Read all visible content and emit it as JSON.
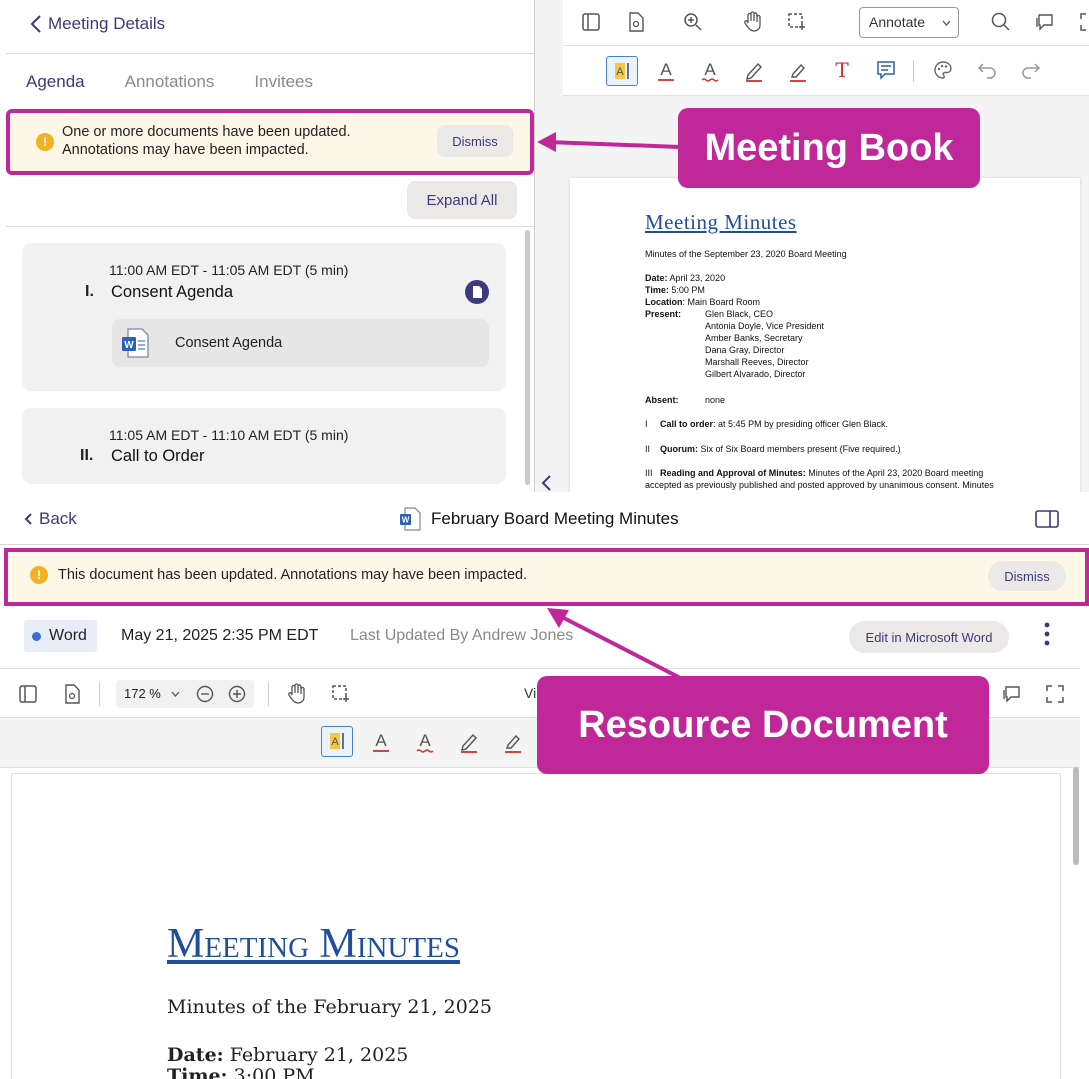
{
  "meeting_panel": {
    "back_label": "Meeting Details",
    "tabs": [
      {
        "label": "Agenda",
        "active": true
      },
      {
        "label": "Annotations",
        "active": false
      },
      {
        "label": "Invitees",
        "active": false
      }
    ],
    "banner": {
      "line1": "One or more documents have been updated.",
      "line2": "Annotations may have been impacted.",
      "dismiss": "Dismiss",
      "icon": "exclamation"
    },
    "expand_all": "Expand All",
    "agenda": [
      {
        "time": "11:00 AM EDT - 11:05 AM EDT (5 min)",
        "number": "I.",
        "title": "Consent Agenda",
        "document": "Consent Agenda"
      },
      {
        "time": "11:05 AM EDT - 11:10 AM EDT (5 min)",
        "number": "II.",
        "title": "Call to Order"
      }
    ]
  },
  "meeting_book": {
    "annotate_select": "Annotate",
    "doc": {
      "title": "Meeting Minutes",
      "subtitle": "Minutes of the September 23, 2020 Board Meeting",
      "date_label": "Date:",
      "date": "April 23, 2020",
      "time_label": "Time:",
      "time": "5:00 PM",
      "location_label": "Location",
      "location": "Main Board Room",
      "present_label": "Present:",
      "present": [
        "Glen Black, CEO",
        "Antonia Doyle, Vice President",
        "Amber Banks, Secretary",
        "Dana Gray, Director",
        "Marshall Reeves, Director",
        "Gilbert Alvarado, Director"
      ],
      "absent_label": "Absent:",
      "absent": "none",
      "item1_num": "I",
      "item1_label": "Call to order",
      "item1_text": ": at 5:45 PM by presiding officer Glen Black.",
      "item2_num": "II",
      "item2_label": "Quorum:",
      "item2_text": " Six of Six Board members present (Five required.)",
      "item3_num": "III",
      "item3_label": "Reading and Approval of Minutes:",
      "item3_text": " Minutes of the April 23, 2020 Board meeting",
      "item3_cont": "accepted as previously published and posted approved by unanimous consent. Minutes"
    }
  },
  "resource_doc": {
    "back": "Back",
    "title": "February Board Meeting Minutes",
    "banner": {
      "text": "This document has been updated. Annotations may have been impacted.",
      "dismiss": "Dismiss"
    },
    "file_type": "Word",
    "date": "May 21, 2025 2:35 PM EDT",
    "updated_by": "Last Updated By Andrew Jones",
    "edit_button": "Edit in Microsoft Word",
    "zoom": "172 %",
    "view_partial": "Vi",
    "doc": {
      "title": "Meeting Minutes",
      "subtitle": "Minutes of the February 21, 2025",
      "date_label": "Date:",
      "date": "February 21, 2025",
      "time_label": "Time:",
      "time": "3:00 PM"
    }
  },
  "callouts": {
    "top": "Meeting Book",
    "bottom": "Resource Document",
    "color": "#c0289a"
  },
  "colors": {
    "accent": "#3b3a7a",
    "highlight": "#c0289a",
    "warning": "#f2b320",
    "doc_title": "#1f4e9c"
  }
}
